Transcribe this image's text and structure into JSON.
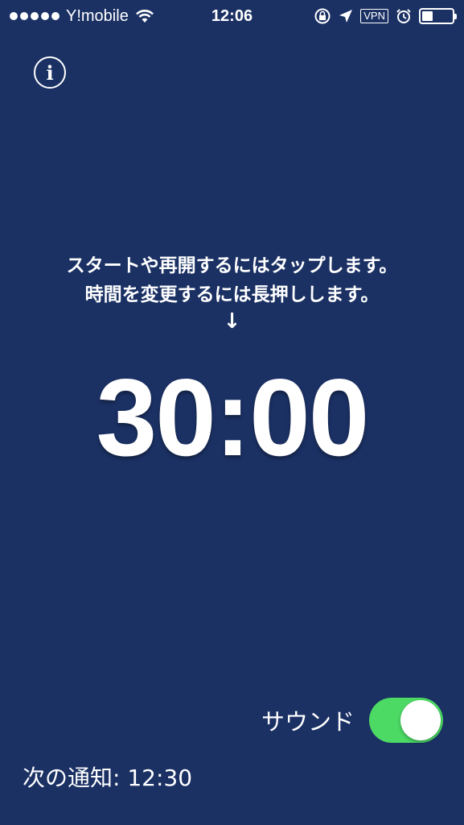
{
  "status_bar": {
    "carrier": "Y!mobile",
    "time": "12:06",
    "vpn": "VPN",
    "signal_bars": 5,
    "battery_level": 0.35
  },
  "info": {
    "icon": "info-icon",
    "symbol": "i"
  },
  "instructions": {
    "line1": "スタートや再開するにはタップします。",
    "line2": "時間を変更するには長押しします。",
    "arrow": "↓"
  },
  "timer": {
    "display": "30:00"
  },
  "sound": {
    "label": "サウンド",
    "enabled": true,
    "accent": "#4cd964"
  },
  "next_notification": {
    "text": "次の通知: 12:30"
  },
  "colors": {
    "background": "#1b3164",
    "text": "#ffffff"
  }
}
